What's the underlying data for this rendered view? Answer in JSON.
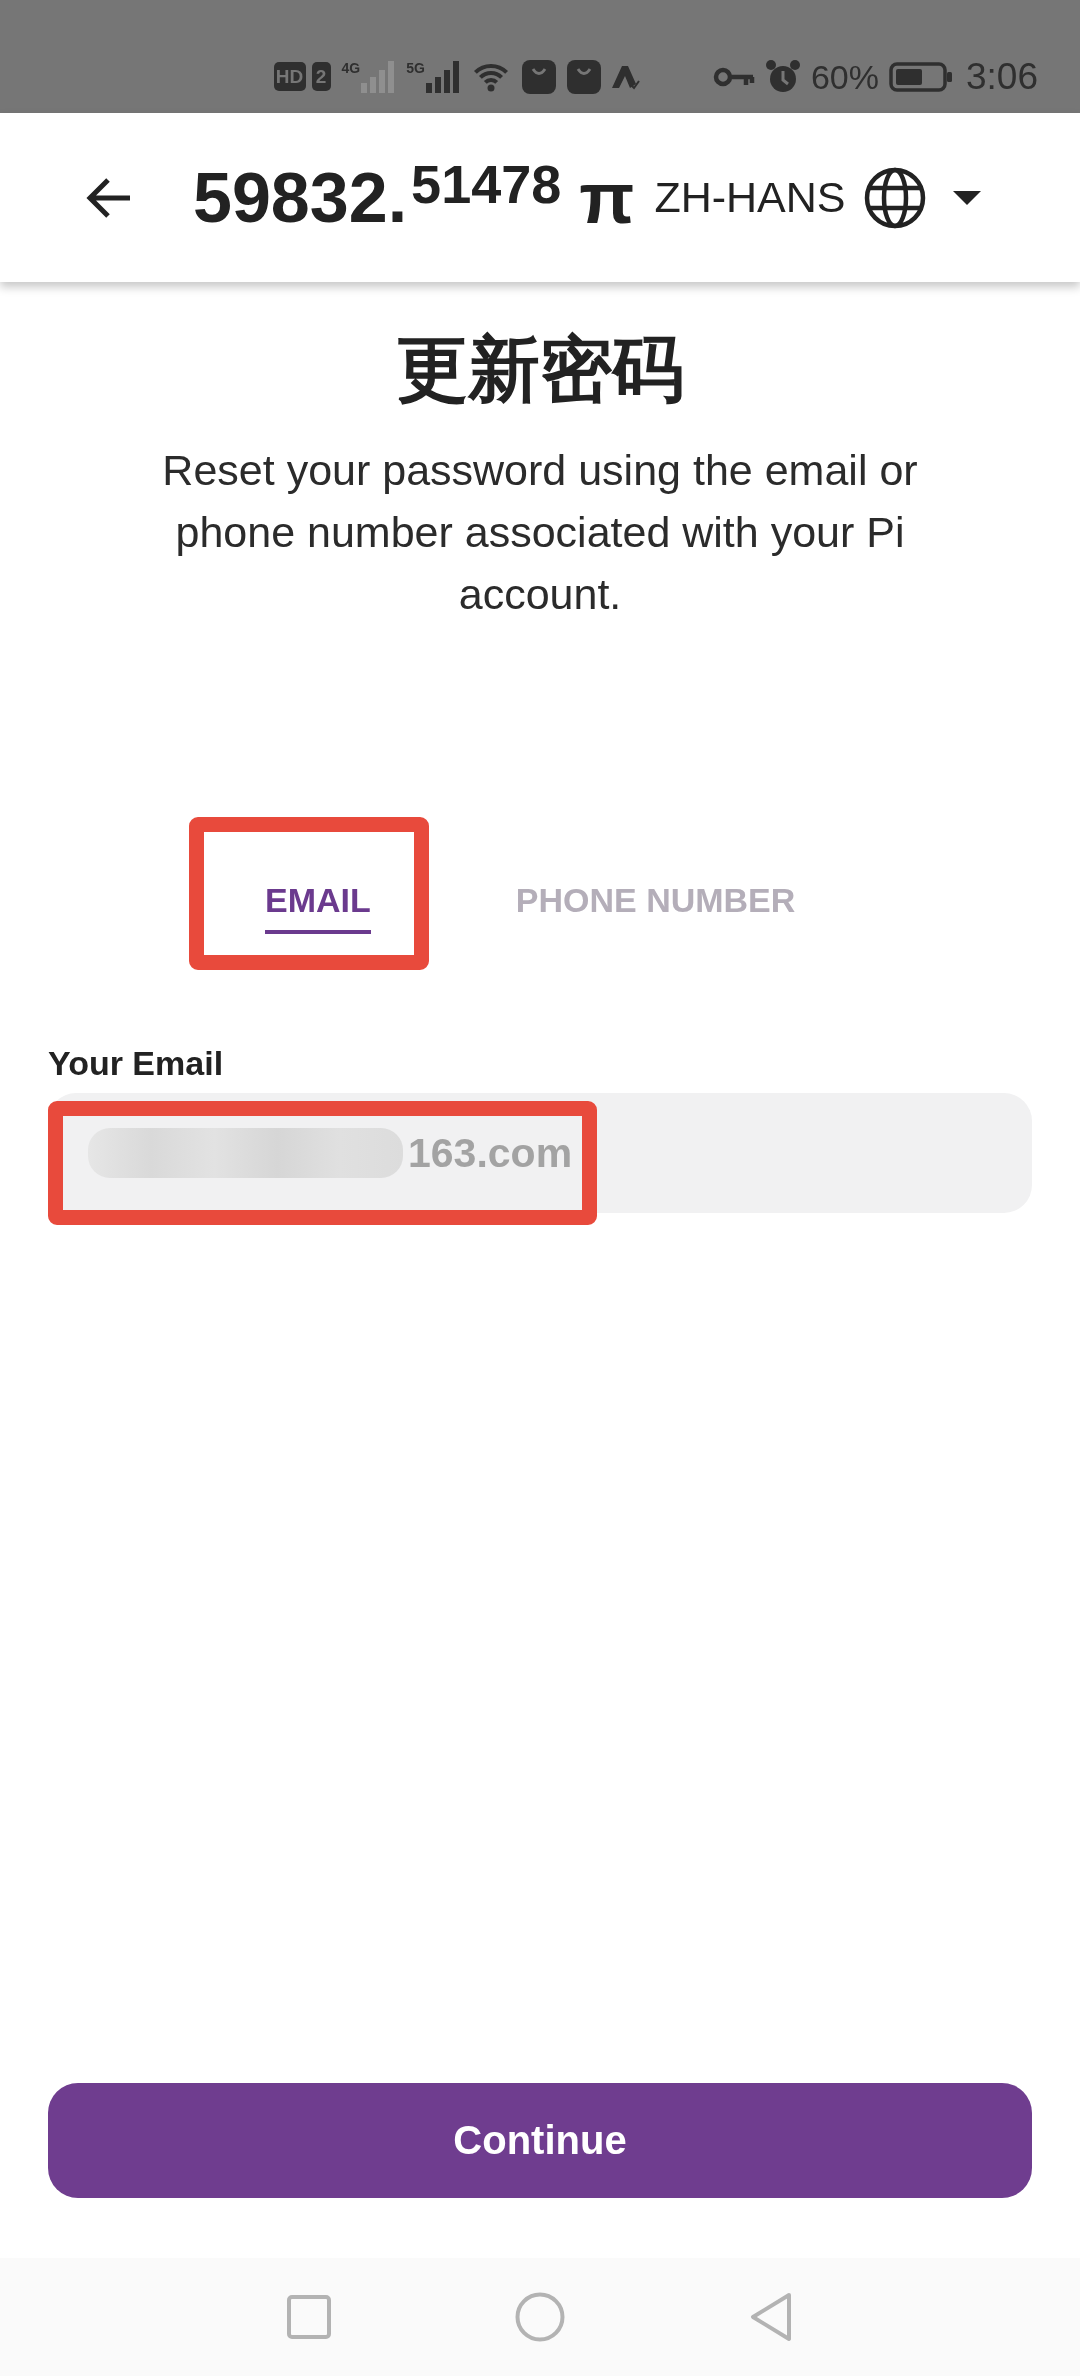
{
  "status_bar": {
    "indicators": [
      "HD",
      "2"
    ],
    "networks": [
      {
        "label": "4G",
        "active": false
      },
      {
        "label": "5G",
        "active": true
      }
    ],
    "battery": "60%",
    "time": "3:06"
  },
  "header": {
    "balance": "59832.$^{51478}$",
    "currency": "π",
    "language": "ZH-HANS"
  },
  "title": "更新密码",
  "description": "Reset your password using the email or phone number associated with your Pi account.",
  "tabs": [
    {
      "label": "EMAIL",
      "selected": true,
      "highlighted": true
    },
    {
      "label": "PHONE NUMBER",
      "selected": false,
      "highlighted": false
    }
  ],
  "email_field": {
    "label": "Your Email",
    "value": "163.com",
    "redacted": true,
    "highlighted": true
  },
  "continue_button": {
    "label": "Continue"
  }
}
